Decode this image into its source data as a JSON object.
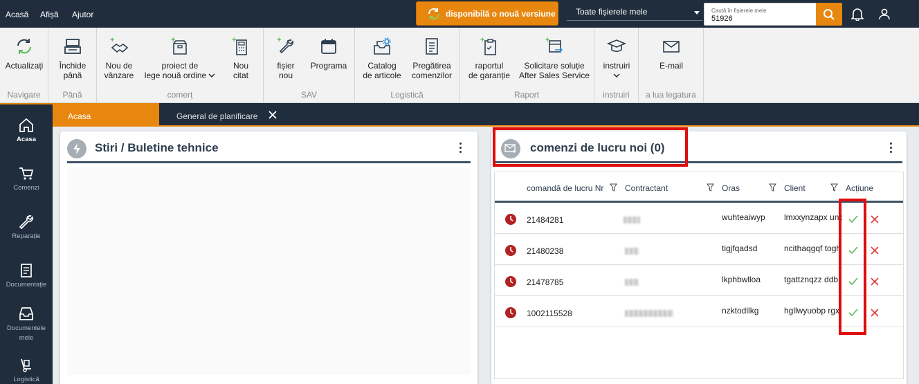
{
  "topbar": {
    "menus": [
      "Acasă",
      "Afișă",
      "Ajutor"
    ],
    "update_label": "disponibilă o nouă versiune",
    "files_select": "Toate fișierele mele",
    "search_placeholder": "Caută în fișierele mele",
    "search_value": "51926"
  },
  "ribbon": {
    "groups": [
      "Navigare",
      "Până",
      "comerț",
      "SAV",
      "Logistică",
      "Raport",
      "instruiri",
      "a lua legatura"
    ],
    "buttons": {
      "refresh": [
        "Actualizați"
      ],
      "close": [
        "Închide",
        "până"
      ],
      "new_sale": [
        "Nou de",
        "vânzare"
      ],
      "project": [
        "proiect de",
        "lege nouă ordine"
      ],
      "new_quote": [
        "Nou",
        "citat"
      ],
      "file": [
        "fișier",
        "nou"
      ],
      "schedule": [
        "Programa"
      ],
      "catalog": [
        "Catalog",
        "de articole"
      ],
      "prep": [
        "Pregătirea",
        "comenzilor"
      ],
      "warranty": [
        "raportul",
        "de garanție"
      ],
      "after_sales": [
        "Solicitare soluție",
        "After Sales Service"
      ],
      "training": [
        "instruiri"
      ],
      "email": [
        "E-mail"
      ]
    }
  },
  "sidebar": {
    "items": [
      "Acasa",
      "Comenzi",
      "Reparație",
      "Documentație",
      "Documentele mele",
      "Logistică"
    ]
  },
  "tabs": {
    "home": "Acasa",
    "planning": "General de planificare"
  },
  "news_panel": {
    "title": "Stiri / Buletine tehnice"
  },
  "orders_panel": {
    "title": "comenzi de lucru noi (0)",
    "columns": [
      "comandă de lucru Nr",
      "Contractant",
      "Oras",
      "Client",
      "Acțiune"
    ],
    "rows": [
      {
        "nr": "21484281",
        "oras": "wuhteaiwyp",
        "client": "lmxxynzapx unc"
      },
      {
        "nr": "21480238",
        "oras": "tigjfqadsd",
        "client": "ncithaqgqf togh"
      },
      {
        "nr": "21478785",
        "oras": "lkphbwlloa",
        "client": "tgattznqzz ddb:"
      },
      {
        "nr": "1002115528",
        "oras": "nzktodllkg",
        "client": "hgllwyuobp rgx"
      }
    ]
  },
  "colors": {
    "accent": "#e8870f",
    "navy": "#1f2d3d",
    "highlight": "#e10c0c",
    "accept": "#5cb85c",
    "reject": "#e03a3a"
  }
}
